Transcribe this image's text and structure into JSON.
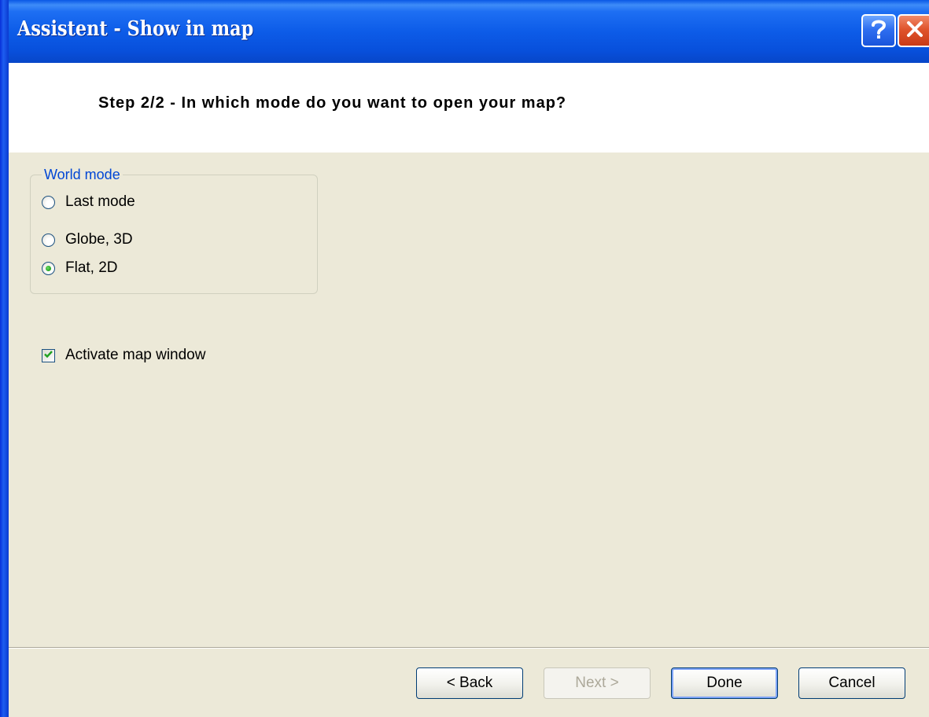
{
  "window": {
    "title": "Assistent - Show in map",
    "help_icon": "question-mark",
    "close_icon": "x"
  },
  "header": {
    "step_title": "Step 2/2 - In which mode do you want to open your map?"
  },
  "world_mode": {
    "legend": "World mode",
    "options": [
      {
        "label": "Last mode",
        "selected": false
      },
      {
        "label": "Globe, 3D",
        "selected": false
      },
      {
        "label": "Flat, 2D",
        "selected": true
      }
    ]
  },
  "activate_map": {
    "label": "Activate map window",
    "checked": true
  },
  "buttons": {
    "back": "< Back",
    "next": "Next >",
    "done": "Done",
    "cancel": "Cancel"
  },
  "colors": {
    "titlebar": "#0d5ce8",
    "dialog_bg": "#ece9d8",
    "group_legend": "#0046d5",
    "radio_dot": "#21a121",
    "check_mark": "#21a121"
  }
}
